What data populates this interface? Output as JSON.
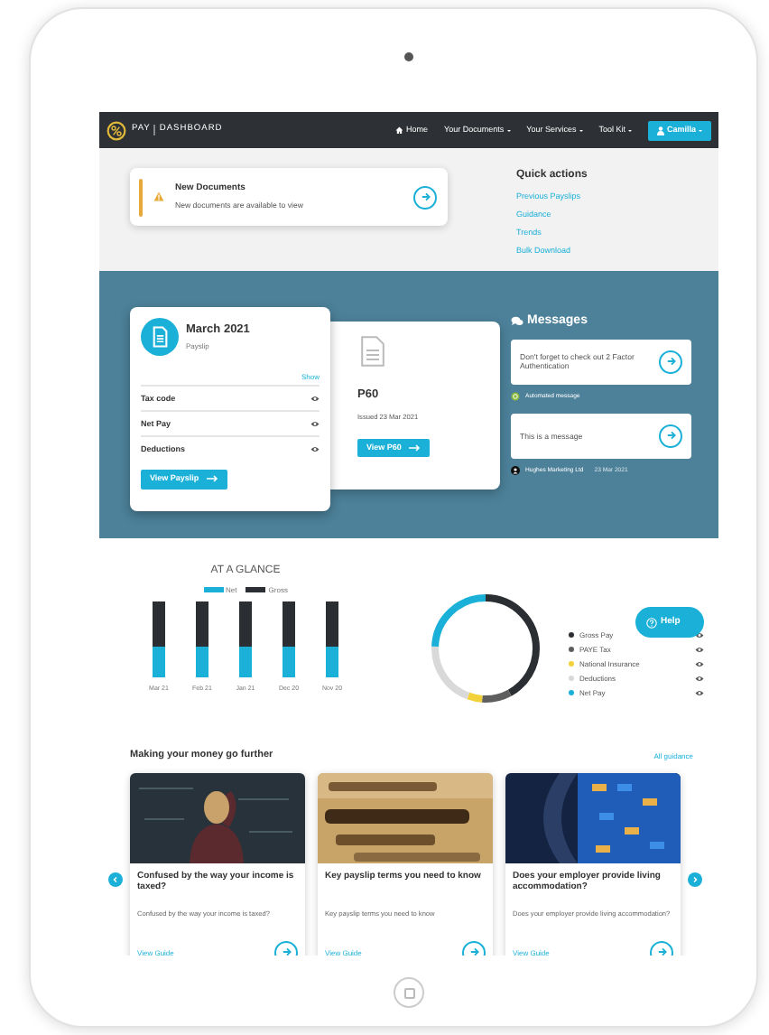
{
  "nav": {
    "brand": [
      "PAY",
      "DASHBOARD"
    ],
    "items": [
      {
        "label": "Home",
        "kind": "home"
      },
      {
        "label": "Your Documents",
        "kind": "dropdown"
      },
      {
        "label": "Your Services",
        "kind": "dropdown"
      },
      {
        "label": "Tool Kit",
        "kind": "dropdown"
      }
    ],
    "user_button": "Camilla"
  },
  "notice": {
    "title": "New Documents",
    "text": "New documents are available to view"
  },
  "quick_actions": {
    "title": "Quick actions",
    "links": [
      "Previous Payslips",
      "Guidance",
      "Trends",
      "Bulk Download"
    ]
  },
  "payslip": {
    "month": "March 2021",
    "subtitle": "Payslip",
    "toggle": "Show",
    "rows": [
      "Tax code",
      "Net Pay",
      "Deductions"
    ],
    "button": "View Payslip"
  },
  "p60": {
    "title": "P60",
    "issued": "Issued 23 Mar 2021",
    "button": "View P60"
  },
  "messages": {
    "title": "Messages",
    "items": [
      {
        "text": "Don't forget to check out 2 Factor Authentication",
        "sender": "Automated message",
        "kind": "automated"
      },
      {
        "text": "This is a message",
        "sender": "Hughes Marketing Ltd",
        "date": "23 Mar 2021",
        "kind": "company"
      }
    ]
  },
  "glance": {
    "title": "AT A GLANCE",
    "legend": [
      {
        "label": "Net",
        "color": "#1ab0d8"
      },
      {
        "label": "Gross",
        "color": "#2b2f33"
      }
    ],
    "months": [
      "Mar 21",
      "Feb 21",
      "Jan 21",
      "Dec 20",
      "Nov 20"
    ]
  },
  "breakdown": [
    {
      "label": "Gross Pay",
      "color": "#2b2f33"
    },
    {
      "label": "PAYE Tax",
      "color": "#5e5e5e"
    },
    {
      "label": "National Insurance",
      "color": "#f2d13a"
    },
    {
      "label": "Deductions",
      "color": "#d9d9d9"
    },
    {
      "label": "Net Pay",
      "color": "#1ab0d8"
    }
  ],
  "help_button": "Help",
  "guides": {
    "title": "Making your money go further",
    "all_link": "All guidance",
    "cards": [
      {
        "title": "Confused by the way your income is taxed?",
        "text": "Confused by the way your income is taxed?",
        "link": "View Guide"
      },
      {
        "title": "Key payslip terms you need to know",
        "text": "Key payslip terms you need to know",
        "link": "View Guide"
      },
      {
        "title": "Does your employer provide living accommodation?",
        "text": "Does your employer provide living accommodation?",
        "link": "View Guide"
      }
    ]
  }
}
